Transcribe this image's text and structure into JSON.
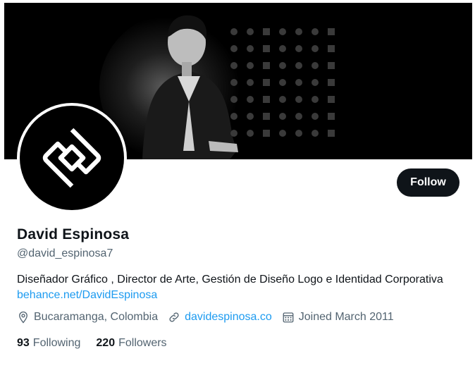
{
  "profile": {
    "name": "David Espinosa",
    "handle": "@david_espinosa7",
    "bio_text": "Diseñador Gráfico , Director de Arte, Gestión de Diseño Logo e Identidad Corporativa",
    "bio_link": "behance.net/DavidEspinosa",
    "location": "Bucaramanga, Colombia",
    "website": "davidespinosa.co",
    "joined": "Joined March 2011",
    "following_count": "93",
    "following_label": "Following",
    "followers_count": "220",
    "followers_label": "Followers"
  },
  "actions": {
    "follow_label": "Follow"
  },
  "icons": {
    "location": "location-pin-icon",
    "website": "link-icon",
    "joined": "calendar-icon"
  },
  "colors": {
    "accent": "#1d9bf0",
    "text": "#0f1419",
    "secondary": "#536471",
    "button_bg": "#0f1419"
  }
}
